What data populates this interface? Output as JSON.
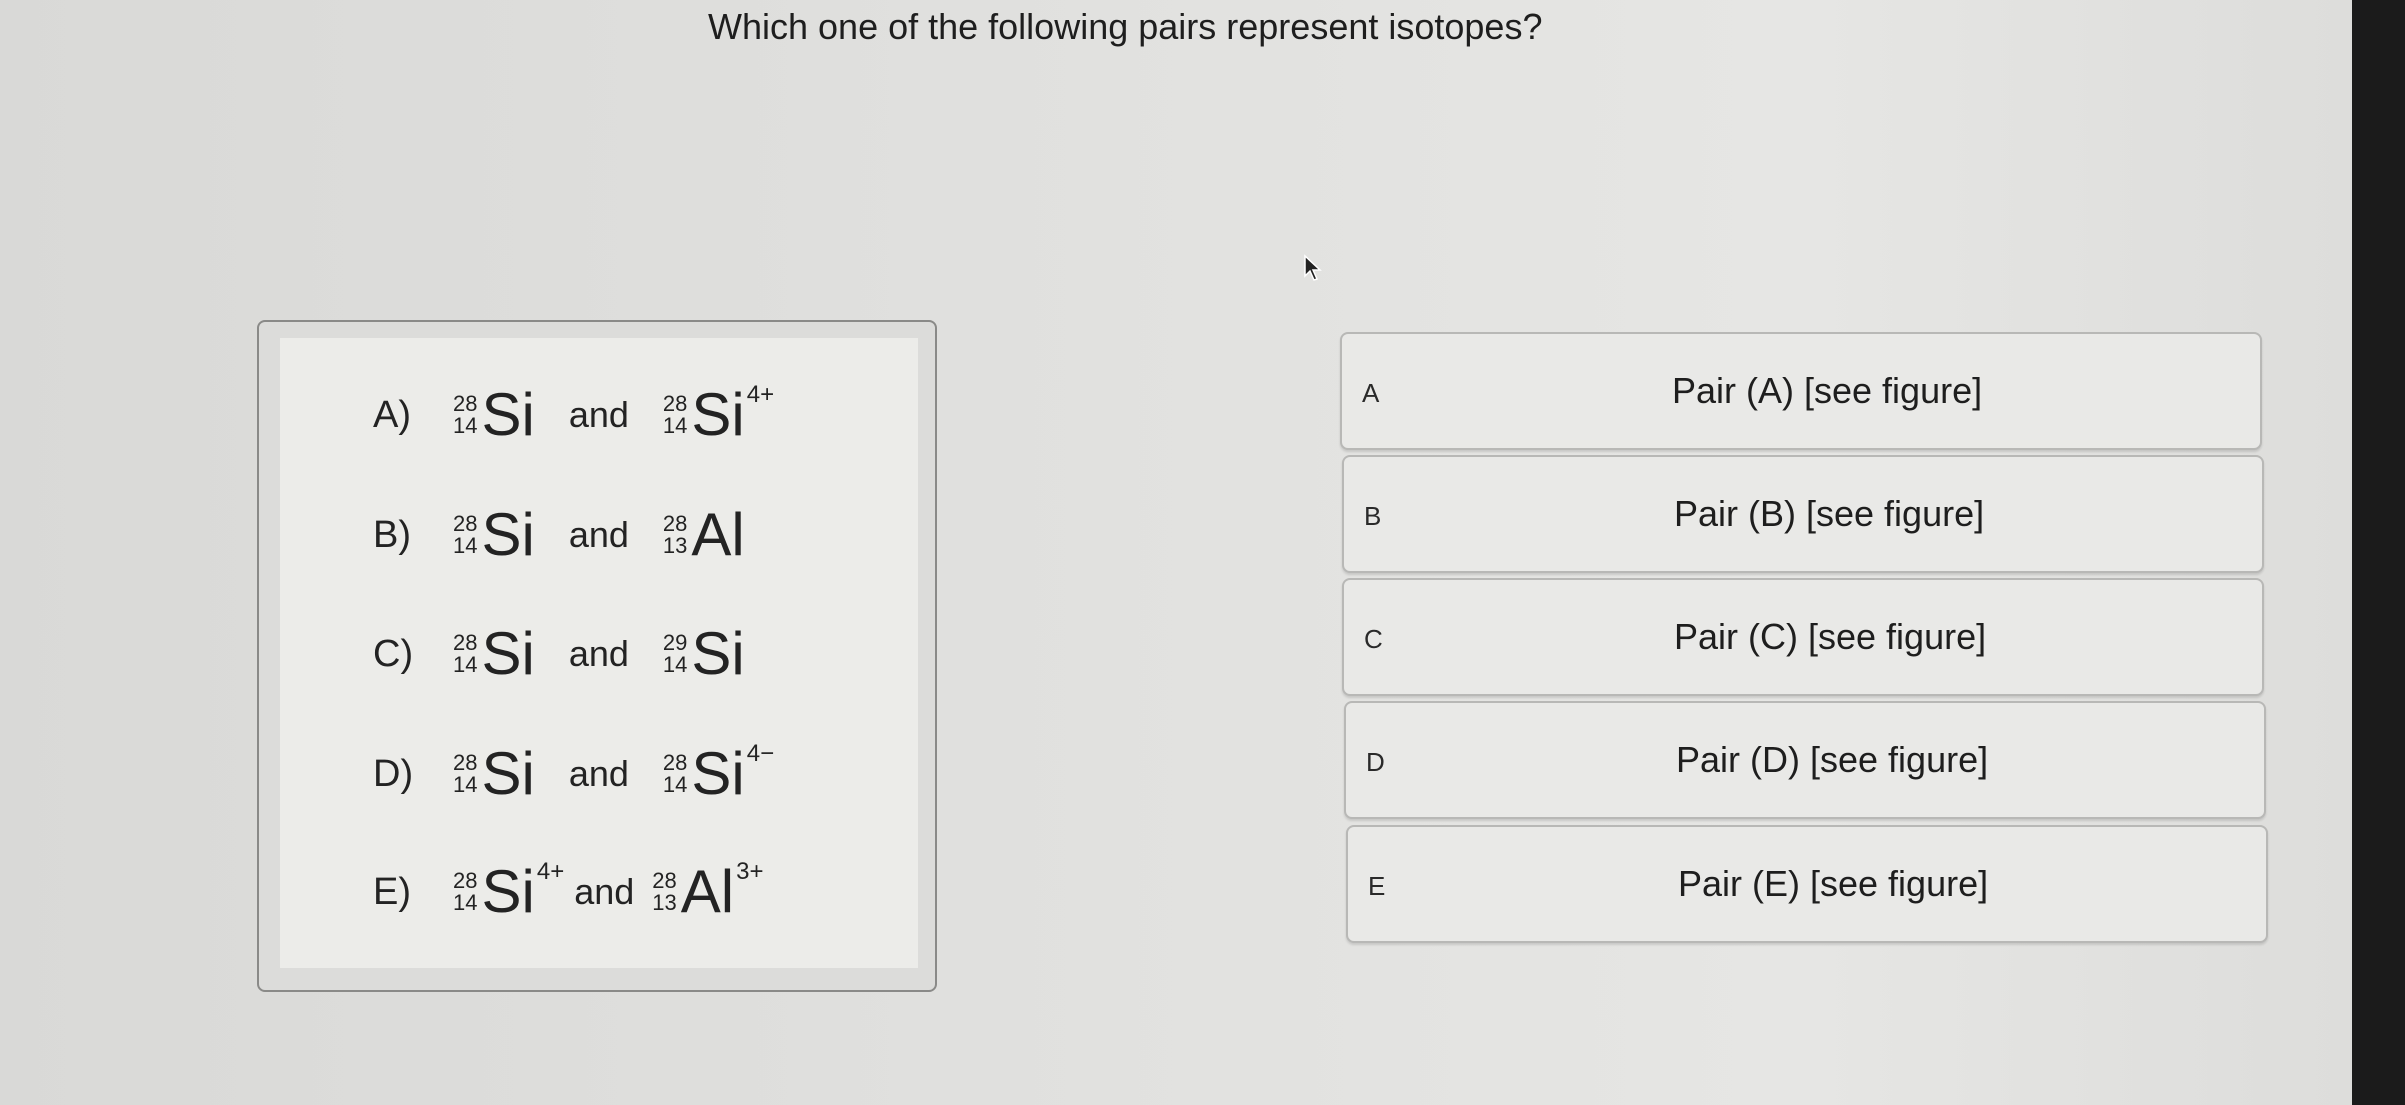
{
  "question": "Which one of the following pairs represent isotopes?",
  "figure": {
    "rows": [
      {
        "letter": "A)",
        "left": {
          "mass": "28",
          "atomic": "14",
          "symbol": "Si",
          "charge": ""
        },
        "and": "and",
        "right": {
          "mass": "28",
          "atomic": "14",
          "symbol": "Si",
          "charge": "4+"
        }
      },
      {
        "letter": "B)",
        "left": {
          "mass": "28",
          "atomic": "14",
          "symbol": "Si",
          "charge": ""
        },
        "and": "and",
        "right": {
          "mass": "28",
          "atomic": "13",
          "symbol": "Al",
          "charge": ""
        }
      },
      {
        "letter": "C)",
        "left": {
          "mass": "28",
          "atomic": "14",
          "symbol": "Si",
          "charge": ""
        },
        "and": "and",
        "right": {
          "mass": "29",
          "atomic": "14",
          "symbol": "Si",
          "charge": ""
        }
      },
      {
        "letter": "D)",
        "left": {
          "mass": "28",
          "atomic": "14",
          "symbol": "Si",
          "charge": ""
        },
        "and": "and",
        "right": {
          "mass": "28",
          "atomic": "14",
          "symbol": "Si",
          "charge": "4−"
        }
      },
      {
        "letter": "E)",
        "left": {
          "mass": "28",
          "atomic": "14",
          "symbol": "Si",
          "charge": "4+"
        },
        "and": "and",
        "right": {
          "mass": "28",
          "atomic": "13",
          "symbol": "Al",
          "charge": "3+"
        }
      }
    ]
  },
  "options": [
    {
      "letter": "A",
      "text": "Pair (A)  [see figure]"
    },
    {
      "letter": "B",
      "text": "Pair (B)  [see figure]"
    },
    {
      "letter": "C",
      "text": "Pair (C)  [see figure]"
    },
    {
      "letter": "D",
      "text": "Pair (D)  [see figure]"
    },
    {
      "letter": "E",
      "text": "Pair (E)  [see figure]"
    }
  ]
}
